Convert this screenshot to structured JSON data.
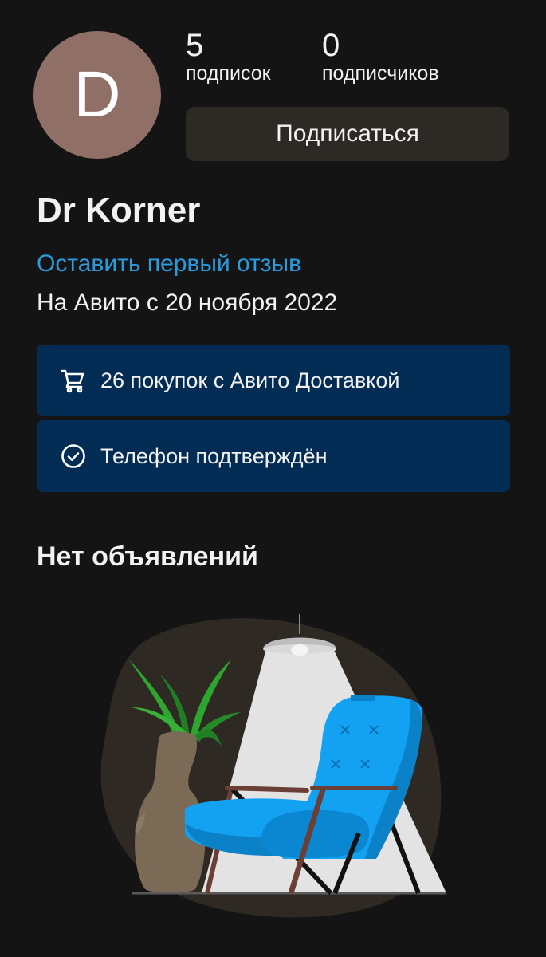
{
  "profile": {
    "avatar_letter": "D",
    "name": "Dr Korner",
    "subscriptions_count": "5",
    "subscriptions_label": "подписок",
    "followers_count": "0",
    "followers_label": "подписчиков",
    "follow_button": "Подписаться",
    "review_link": "Оставить первый отзыв",
    "member_since": "На Авито с 20 ноября 2022"
  },
  "badges": [
    {
      "icon": "cart-icon",
      "text": "26 покупок с Авито Доставкой"
    },
    {
      "icon": "check-circle-icon",
      "text": "Телефон подтверждён"
    }
  ],
  "listings": {
    "empty_title": "Нет объявлений"
  },
  "colors": {
    "background": "#141414",
    "avatar": "#8f6f66",
    "follow_button_bg": "#2d2a25",
    "link": "#2b9be0",
    "badge_bg": "#022c54",
    "chair_blue": "#13a2f2"
  }
}
